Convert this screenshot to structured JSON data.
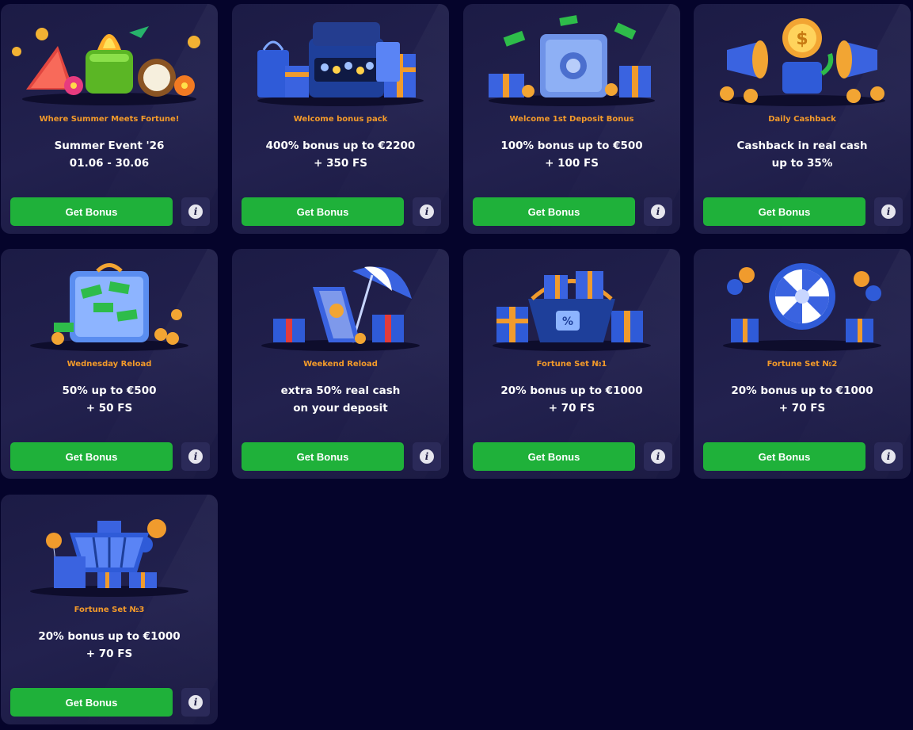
{
  "promotions": [
    {
      "subtitle": "Where Summer Meets Fortune!",
      "title_lines": [
        "Summer Event '26",
        "01.06 - 30.06"
      ],
      "button": "Get Bonus",
      "icon": "summer-tropical-illustration"
    },
    {
      "subtitle": "Welcome bonus pack",
      "title_lines": [
        "400% bonus up to €2200",
        "+ 350 FS"
      ],
      "button": "Get Bonus",
      "icon": "treasure-suitcase-illustration"
    },
    {
      "subtitle": "Welcome 1st Deposit Bonus",
      "title_lines": [
        "100% bonus up to €500",
        "+ 100 FS"
      ],
      "button": "Get Bonus",
      "icon": "safe-illustration"
    },
    {
      "subtitle": "Daily Cashback",
      "title_lines": [
        "Cashback in real cash",
        "up to 35%"
      ],
      "button": "Get Bonus",
      "icon": "cashback-megaphone-illustration"
    },
    {
      "subtitle": "Wednesday Reload",
      "title_lines": [
        "50% up to €500",
        "+ 50 FS"
      ],
      "button": "Get Bonus",
      "icon": "money-suitcase-illustration"
    },
    {
      "subtitle": "Weekend Reload",
      "title_lines": [
        "extra 50% real cash",
        "on your deposit"
      ],
      "button": "Get Bonus",
      "icon": "beach-chair-illustration"
    },
    {
      "subtitle": "Fortune Set №1",
      "title_lines": [
        "20% bonus up to €1000",
        "+ 70 FS"
      ],
      "button": "Get Bonus",
      "icon": "gift-basket-illustration"
    },
    {
      "subtitle": "Fortune Set №2",
      "title_lines": [
        "20% bonus up to €1000",
        "+ 70 FS"
      ],
      "button": "Get Bonus",
      "icon": "fortune-wheel-illustration"
    },
    {
      "subtitle": "Fortune Set №3",
      "title_lines": [
        "20% bonus up to €1000",
        "+ 70 FS"
      ],
      "button": "Get Bonus",
      "icon": "shopping-cart-illustration"
    }
  ],
  "info_icon_glyph": "i",
  "colors": {
    "background": "#05042b",
    "card": "#1f1e4a",
    "subtitle": "#f39a2a",
    "button": "#1fb13a",
    "info_button": "#2b2a59"
  }
}
